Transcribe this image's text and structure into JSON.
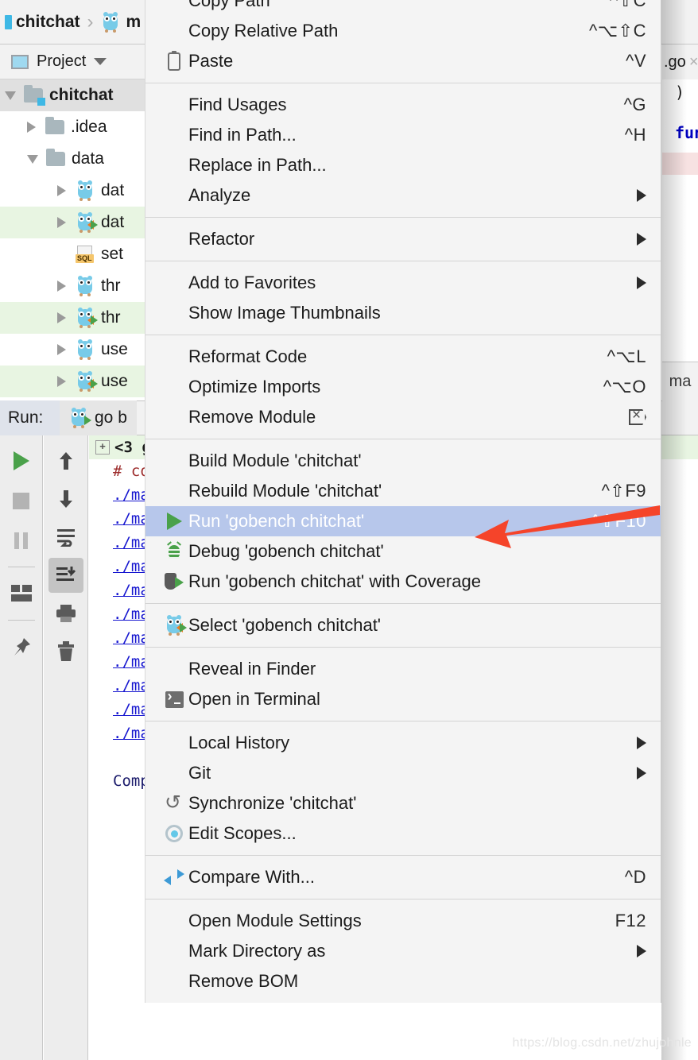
{
  "breadcrumb": {
    "project": "chitchat",
    "separator": "›",
    "file_partial": "m",
    "module_icon": "go-module-icon",
    "gopher_icon": "go-gopher-icon"
  },
  "tool_window": {
    "title": "Project",
    "panel_icon": "project-panel-icon",
    "dropdown_icon": "chevron-down-icon"
  },
  "tree": [
    {
      "label": "chitchat",
      "icon": "folder-module-icon",
      "state": "expanded",
      "depth": 0,
      "selected": true,
      "modified": false
    },
    {
      "label": ".idea",
      "icon": "folder-icon",
      "state": "collapsed",
      "depth": 1,
      "selected": false,
      "modified": false
    },
    {
      "label": "data",
      "icon": "folder-icon",
      "state": "expanded",
      "depth": 1,
      "selected": false,
      "modified": false
    },
    {
      "label": "dat",
      "icon": "go-file-icon",
      "state": "collapsed",
      "depth": 2,
      "selected": false,
      "modified": false
    },
    {
      "label": "dat",
      "icon": "go-file-run-icon",
      "state": "collapsed",
      "depth": 2,
      "selected": false,
      "modified": true
    },
    {
      "label": "set",
      "icon": "sql-file-icon",
      "state": "leaf",
      "depth": 2,
      "selected": false,
      "modified": false
    },
    {
      "label": "thr",
      "icon": "go-file-icon",
      "state": "collapsed",
      "depth": 2,
      "selected": false,
      "modified": false
    },
    {
      "label": "thr",
      "icon": "go-file-run-icon",
      "state": "collapsed",
      "depth": 2,
      "selected": false,
      "modified": true
    },
    {
      "label": "use",
      "icon": "go-file-icon",
      "state": "collapsed",
      "depth": 2,
      "selected": false,
      "modified": false
    },
    {
      "label": "use",
      "icon": "go-file-run-icon",
      "state": "collapsed",
      "depth": 2,
      "selected": false,
      "modified": true
    }
  ],
  "sql_tag": "SQL",
  "run_panel": {
    "label": "Run:",
    "tab_label": "go b",
    "tab_icon": "go-run-config-icon",
    "toolbar_left": [
      {
        "name": "rerun-button",
        "icon": "play-icon"
      },
      {
        "name": "stop-button",
        "icon": "stop-icon"
      },
      {
        "name": "pause-button",
        "icon": "pause-icon"
      },
      {
        "name": "layout-button",
        "icon": "layout-icon"
      },
      {
        "name": "pin-button",
        "icon": "pin-icon"
      }
    ],
    "toolbar_right": [
      {
        "name": "up-stack-button",
        "icon": "arrow-up-icon"
      },
      {
        "name": "down-stack-button",
        "icon": "arrow-down-icon"
      },
      {
        "name": "soft-wrap-button",
        "icon": "soft-wrap-icon"
      },
      {
        "name": "scroll-to-end-button",
        "icon": "scroll-end-icon",
        "active": true
      },
      {
        "name": "print-button",
        "icon": "printer-icon"
      },
      {
        "name": "clear-all-button",
        "icon": "trash-icon"
      }
    ]
  },
  "console": {
    "lines": [
      {
        "text": "<3  g",
        "style": "green",
        "fold": true
      },
      {
        "text": "#  co",
        "style": "red"
      },
      {
        "text": "./ma",
        "style": "link"
      },
      {
        "text": "./ma",
        "style": "link"
      },
      {
        "text": "./ma",
        "style": "link"
      },
      {
        "text": "./ma",
        "style": "link"
      },
      {
        "text": "./ma",
        "style": "link"
      },
      {
        "text": "./ma",
        "style": "link"
      },
      {
        "text": "./ma",
        "style": "link"
      },
      {
        "text": "./ma",
        "style": "link"
      },
      {
        "text": "./ma",
        "style": "link"
      },
      {
        "text": "./ma",
        "style": "link"
      },
      {
        "text": "./ma",
        "style": "link"
      },
      {
        "text": "",
        "style": "blank"
      },
      {
        "text": "Comp",
        "style": "navy"
      }
    ]
  },
  "editor": {
    "tab_label": ".go",
    "tab_close_icon": "close-icon",
    "line_paren": ")",
    "keyword_func": "fun",
    "breadcrumb_func": "ma"
  },
  "context_menu": {
    "groups": [
      {
        "name": "clipboard-group",
        "items": [
          {
            "label": "Copy Path",
            "shortcut": "^⇧C",
            "icon": null,
            "submenu": false
          },
          {
            "label": "Copy Relative Path",
            "shortcut": "^⌥⇧C",
            "icon": null,
            "submenu": false
          },
          {
            "label": "Paste",
            "shortcut": "^V",
            "icon": "paste-icon",
            "submenu": false
          }
        ]
      },
      {
        "name": "search-group",
        "items": [
          {
            "label": "Find Usages",
            "shortcut": "^G",
            "icon": null,
            "submenu": false
          },
          {
            "label": "Find in Path...",
            "shortcut": "^H",
            "icon": null,
            "submenu": false
          },
          {
            "label": "Replace in Path...",
            "shortcut": "",
            "icon": null,
            "submenu": false
          },
          {
            "label": "Analyze",
            "shortcut": "",
            "icon": null,
            "submenu": true
          }
        ]
      },
      {
        "name": "refactor-group",
        "items": [
          {
            "label": "Refactor",
            "shortcut": "",
            "icon": null,
            "submenu": true
          }
        ]
      },
      {
        "name": "favorites-group",
        "items": [
          {
            "label": "Add to Favorites",
            "shortcut": "",
            "icon": null,
            "submenu": true
          },
          {
            "label": "Show Image Thumbnails",
            "shortcut": "",
            "icon": null,
            "submenu": false
          }
        ]
      },
      {
        "name": "code-group",
        "items": [
          {
            "label": "Reformat Code",
            "shortcut": "^⌥L",
            "icon": null,
            "submenu": false
          },
          {
            "label": "Optimize Imports",
            "shortcut": "^⌥O",
            "icon": null,
            "submenu": false
          },
          {
            "label": "Remove Module",
            "shortcut": "",
            "icon": "delete-box-icon",
            "submenu": false,
            "shortcut_icon": true
          }
        ]
      },
      {
        "name": "build-run-group",
        "items": [
          {
            "label": "Build Module 'chitchat'",
            "shortcut": "",
            "icon": null,
            "submenu": false
          },
          {
            "label": "Rebuild Module 'chitchat'",
            "shortcut": "^⇧F9",
            "icon": null,
            "submenu": false
          },
          {
            "label": "Run 'gobench chitchat'",
            "shortcut": "^⇧F10",
            "icon": "run-icon",
            "submenu": false,
            "highlighted": true
          },
          {
            "label": "Debug 'gobench chitchat'",
            "shortcut": "",
            "icon": "debug-icon",
            "submenu": false
          },
          {
            "label": "Run 'gobench chitchat' with Coverage",
            "shortcut": "",
            "icon": "coverage-icon",
            "submenu": false
          }
        ]
      },
      {
        "name": "select-config-group",
        "items": [
          {
            "label": "Select 'gobench chitchat'",
            "shortcut": "",
            "icon": "go-gopher-run-icon",
            "submenu": false
          }
        ]
      },
      {
        "name": "open-group",
        "items": [
          {
            "label": "Reveal in Finder",
            "shortcut": "",
            "icon": null,
            "submenu": false
          },
          {
            "label": "Open in Terminal",
            "shortcut": "",
            "icon": "terminal-icon",
            "submenu": false
          }
        ]
      },
      {
        "name": "vcs-group",
        "items": [
          {
            "label": "Local History",
            "shortcut": "",
            "icon": null,
            "submenu": true
          },
          {
            "label": "Git",
            "shortcut": "",
            "icon": null,
            "submenu": true
          },
          {
            "label": "Synchronize 'chitchat'",
            "shortcut": "",
            "icon": "sync-icon",
            "submenu": false
          },
          {
            "label": "Edit Scopes...",
            "shortcut": "",
            "icon": "scope-icon",
            "submenu": false
          }
        ]
      },
      {
        "name": "compare-group",
        "items": [
          {
            "label": "Compare With...",
            "shortcut": "^D",
            "icon": "compare-icon",
            "submenu": false
          }
        ]
      },
      {
        "name": "module-settings-group",
        "items": [
          {
            "label": "Open Module Settings",
            "shortcut": "F12",
            "icon": null,
            "submenu": false
          },
          {
            "label": "Mark Directory as",
            "shortcut": "",
            "icon": null,
            "submenu": true
          },
          {
            "label": "Remove BOM",
            "shortcut": "",
            "icon": null,
            "submenu": false
          }
        ]
      }
    ]
  },
  "annotation": {
    "type": "arrow",
    "color": "#f5442a",
    "points_to": "Run 'gobench chitchat'"
  },
  "watermark": "https://blog.csdn.net/zhujohnle",
  "colors": {
    "menu_background": "#f4f4f4",
    "menu_highlight": "#b7c7eb",
    "accent_blue": "#3eb8e5",
    "run_green": "#4aa14a",
    "annotation_red": "#f5442a",
    "link_blue": "#1414cf"
  }
}
